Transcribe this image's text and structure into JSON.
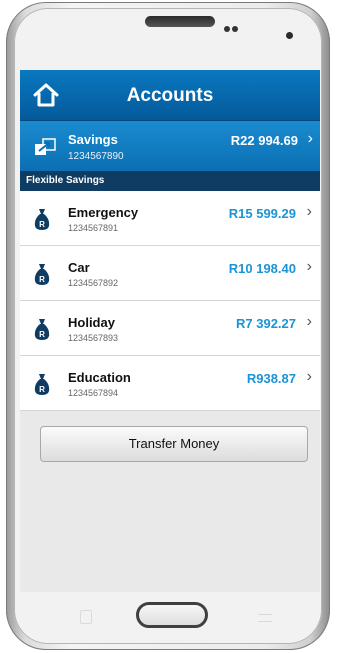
{
  "header": {
    "title": "Accounts",
    "home_icon": "home-icon"
  },
  "main_account": {
    "name": "Savings",
    "number": "1234567890",
    "balance": "R22 994.69",
    "icon": "transfer-icon"
  },
  "section_label": "Flexible Savings",
  "accounts": [
    {
      "name": "Emergency",
      "number": "1234567891",
      "balance": "R15 599.29"
    },
    {
      "name": "Car",
      "number": "1234567892",
      "balance": "R10 198.40"
    },
    {
      "name": "Holiday",
      "number": "1234567893",
      "balance": "R7 392.27"
    },
    {
      "name": "Education",
      "number": "1234567894",
      "balance": "R938.87"
    }
  ],
  "transfer_button": "Transfer Money",
  "colors": {
    "header": "#0a78c0",
    "section": "#0f3c63",
    "amount": "#1a94d6"
  }
}
